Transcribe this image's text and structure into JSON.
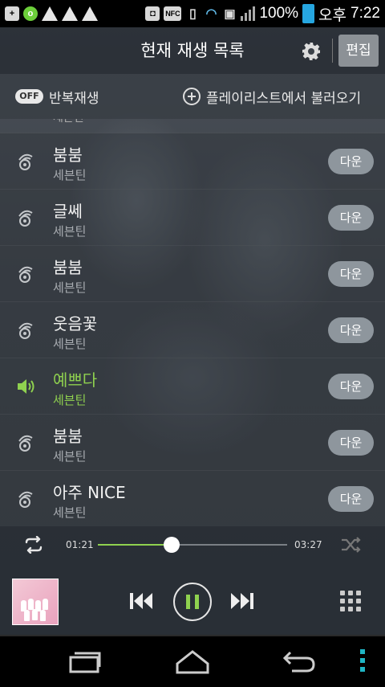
{
  "status_bar": {
    "battery": "100%",
    "ampm": "오후",
    "time": "7:22",
    "nfc": "NFC"
  },
  "header": {
    "title": "현재 재생 목록",
    "edit_label": "편집"
  },
  "options": {
    "repeat_badge": "OFF",
    "repeat_label": "반복재생",
    "load_playlist_label": "플레이리스트에서 불러오기"
  },
  "list": {
    "peek_artist": "세븐틴",
    "items": [
      {
        "title": "붐붐",
        "artist": "세븐틴",
        "button": "다운",
        "playing": false
      },
      {
        "title": "글쎄",
        "artist": "세븐틴",
        "button": "다운",
        "playing": false
      },
      {
        "title": "붐붐",
        "artist": "세븐틴",
        "button": "다운",
        "playing": false
      },
      {
        "title": "웃음꽃",
        "artist": "세븐틴",
        "button": "다운",
        "playing": false
      },
      {
        "title": "예쁘다",
        "artist": "세븐틴",
        "button": "다운",
        "playing": true
      },
      {
        "title": "붐붐",
        "artist": "세븐틴",
        "button": "다운",
        "playing": false
      },
      {
        "title": "아주 NICE",
        "artist": "세븐틴",
        "button": "다운",
        "playing": false
      }
    ]
  },
  "player": {
    "elapsed": "01:21",
    "total": "03:27",
    "progress": 0.39,
    "state": "playing"
  },
  "colors": {
    "accent": "#8fd14f",
    "battery": "#26a6e0",
    "nav_more": "#1fb5c4"
  }
}
